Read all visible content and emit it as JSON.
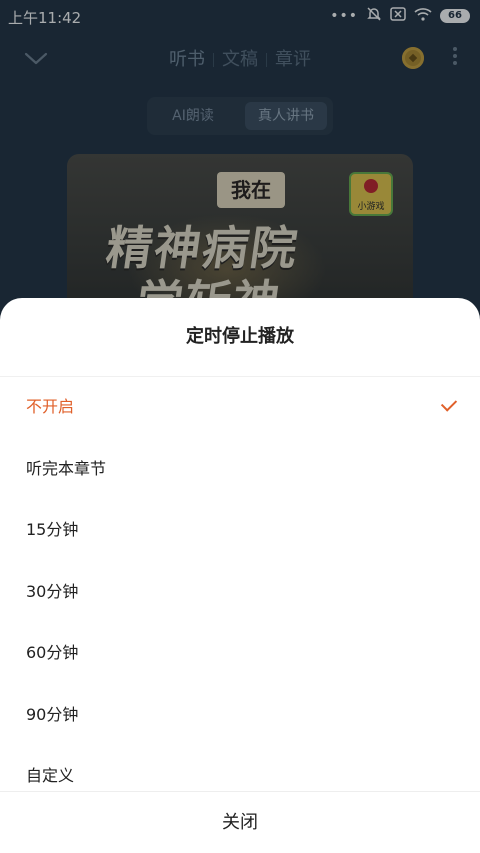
{
  "statusbar": {
    "time": "上午11:42",
    "battery": "66",
    "icons": [
      "signal-dots-icon",
      "mute-icon",
      "close-box-icon",
      "wifi-icon",
      "battery-icon"
    ]
  },
  "topnav": {
    "tabs": [
      {
        "label": "听书",
        "active": true
      },
      {
        "label": "文稿",
        "active": false
      },
      {
        "label": "章评",
        "active": false
      }
    ]
  },
  "mode_switch": {
    "options": [
      {
        "label": "AI朗读",
        "selected": false
      },
      {
        "label": "真人讲书",
        "selected": true
      }
    ]
  },
  "cover": {
    "small_title": "我在",
    "big_title_line1": "精神病院",
    "big_title_line2": "学斩神",
    "badge_label": "小游戏"
  },
  "sheet": {
    "title": "定时停止播放",
    "options": [
      {
        "label": "不开启",
        "selected": true
      },
      {
        "label": "听完本章节",
        "selected": false
      },
      {
        "label": "15分钟",
        "selected": false
      },
      {
        "label": "30分钟",
        "selected": false
      },
      {
        "label": "60分钟",
        "selected": false
      },
      {
        "label": "90分钟",
        "selected": false
      },
      {
        "label": "自定义",
        "selected": false
      }
    ],
    "close_label": "关闭"
  },
  "colors": {
    "accent": "#e0602a",
    "player_bg": "#223242",
    "sheet_bg": "#ffffff"
  }
}
